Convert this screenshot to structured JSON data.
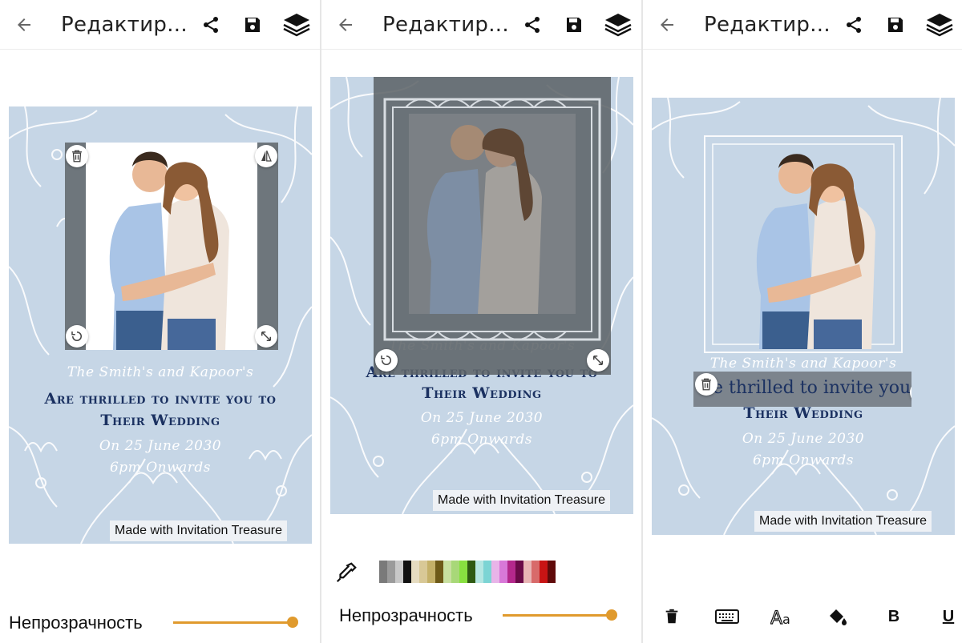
{
  "app": {
    "title": "Редактир...",
    "icons": [
      "back-arrow-icon",
      "share-icon",
      "save-icon",
      "layers-icon"
    ]
  },
  "card": {
    "script_line": "The Smith's and Kapoor's",
    "heading_line1": "Are thrilled to invite you to",
    "heading_line2": "Their Wedding",
    "date_line": "On 25 June 2030",
    "time_line": "6pm Onwards",
    "credit": "Made with Invitation Treasure",
    "background_color": "#c6d6e6",
    "heading_color": "#1b3161"
  },
  "panel1": {
    "opacity_label": "Непрозрачность",
    "opacity_value": 1.0
  },
  "panel2": {
    "opacity_label": "Непрозрачность",
    "opacity_value": 1.0,
    "palette": [
      "#7a7a7a",
      "#9b9b9b",
      "#c8c8c8",
      "#111111",
      "#e6dcc0",
      "#d8c896",
      "#c4b068",
      "#6e5a18",
      "#c8e0a0",
      "#a8d878",
      "#88e040",
      "#2e5a12",
      "#b4e6e2",
      "#7cd4d4",
      "#e8b4e8",
      "#d878d8",
      "#b4288c",
      "#6a0a48",
      "#e8b4b4",
      "#d86a6a",
      "#c81414",
      "#600a0a"
    ]
  },
  "panel3": {
    "editing_text": "e thrilled to invite you",
    "toolbar": [
      "delete-icon",
      "keyboard-icon",
      "font-icon",
      "fill-color-icon",
      "B",
      "U"
    ]
  }
}
